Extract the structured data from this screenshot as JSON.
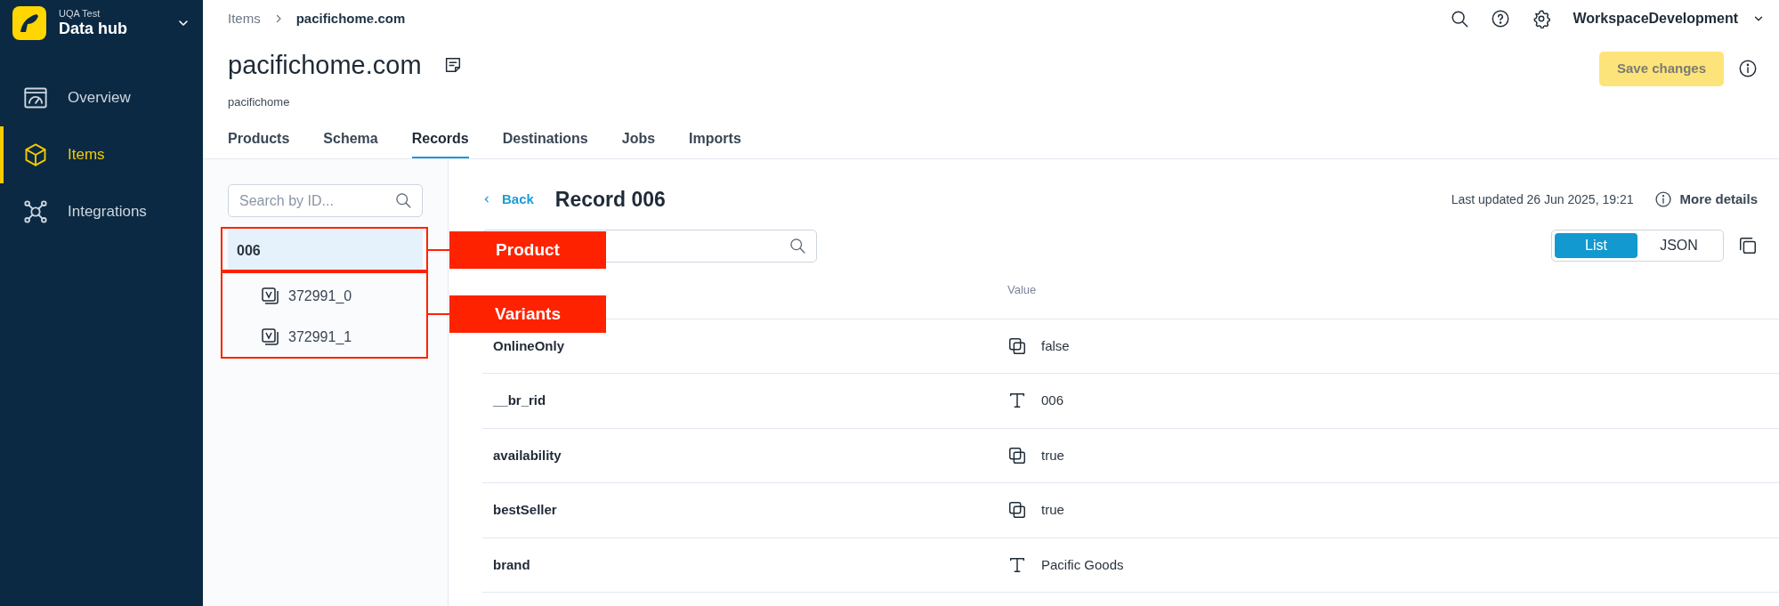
{
  "sidebar": {
    "org": "UQA Test",
    "app": "Data hub",
    "items": [
      {
        "label": "Overview",
        "kind": "overview",
        "selected": false
      },
      {
        "label": "Items",
        "kind": "items",
        "selected": true
      },
      {
        "label": "Integrations",
        "kind": "integrations",
        "selected": false
      }
    ]
  },
  "breadcrumb": [
    {
      "label": "Items",
      "current": false
    },
    {
      "label": "pacifichome.com",
      "current": true
    }
  ],
  "title": "pacifichome.com",
  "subtitle": "pacifichome",
  "workspace": "WorkspaceDevelopment",
  "save_button": {
    "label": "Save changes",
    "disabled": true
  },
  "tabs": [
    {
      "label": "Products",
      "selected": false
    },
    {
      "label": "Schema",
      "selected": false
    },
    {
      "label": "Records",
      "selected": true
    },
    {
      "label": "Destinations",
      "selected": false
    },
    {
      "label": "Jobs",
      "selected": false
    },
    {
      "label": "Imports",
      "selected": false
    }
  ],
  "tree_search": {
    "placeholder": "Search by ID..."
  },
  "tree": [
    {
      "label": "006",
      "selected": true,
      "children": [
        {
          "label": "372991_0",
          "selected": false
        },
        {
          "label": "372991_1",
          "selected": false
        }
      ]
    }
  ],
  "record": {
    "back": "Back",
    "title": "Record 006",
    "last_updated": "Last updated 26 Jun 2025, 19:21",
    "more_details": "More details"
  },
  "view_toggle": [
    {
      "label": "List",
      "selected": true
    },
    {
      "label": "JSON",
      "selected": false
    }
  ],
  "table": {
    "columns": [
      "Value"
    ],
    "rows": [
      {
        "field": "OnlineOnly",
        "kind": "boolean",
        "value": "false"
      },
      {
        "field": "__br_rid",
        "kind": "text",
        "value": "006"
      },
      {
        "field": "availability",
        "kind": "boolean",
        "value": "true"
      },
      {
        "field": "bestSeller",
        "kind": "boolean",
        "value": "true"
      },
      {
        "field": "brand",
        "kind": "text",
        "value": "Pacific Goods"
      }
    ]
  },
  "annotations": [
    {
      "label": "Product"
    },
    {
      "label": "Variants"
    }
  ]
}
